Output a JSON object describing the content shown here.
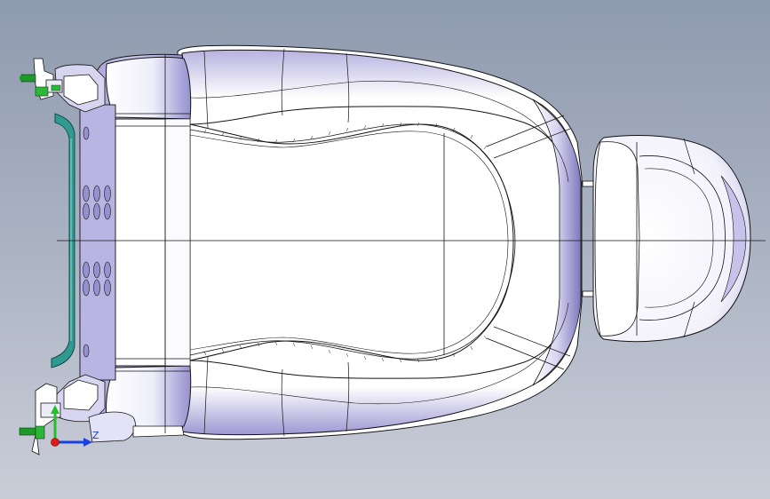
{
  "viewport": {
    "background_top": "#8e9aae",
    "background_bottom": "#c9cdd8"
  },
  "model": {
    "name": "",
    "fill_light": "#ffffff",
    "fill_shade": "#8a84c8",
    "edge_color": "#141414",
    "glass_color": "#2f9a92"
  },
  "triad": {
    "z_label": "Z",
    "y_color": "#22c02a",
    "z_color": "#1b3fe0",
    "x_color": "#e01b1b"
  },
  "icons": [
    "mount-bolt-icon",
    "coordinate-triad-icon"
  ]
}
